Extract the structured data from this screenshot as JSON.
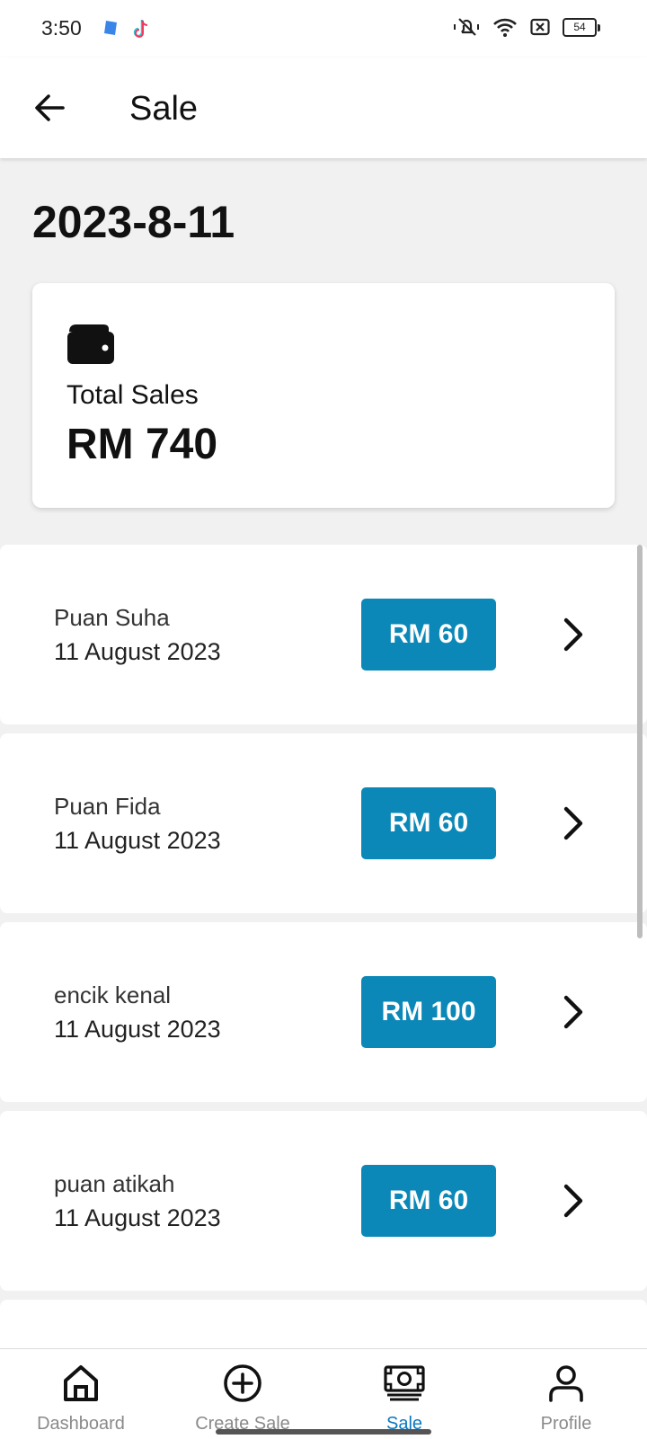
{
  "status_bar": {
    "time": "3:50",
    "battery": "54"
  },
  "app_bar": {
    "title": "Sale"
  },
  "date_heading": "2023-8-11",
  "summary": {
    "label": "Total Sales",
    "value": "RM 740"
  },
  "sales": [
    {
      "name": "Puan Suha",
      "date": " 11 August 2023",
      "amount": "RM 60"
    },
    {
      "name": "Puan Fida",
      "date": " 11 August 2023",
      "amount": "RM 60"
    },
    {
      "name": "encik kenal",
      "date": " 11 August 2023",
      "amount": "RM 100"
    },
    {
      "name": "puan atikah",
      "date": " 11 August 2023",
      "amount": "RM 60"
    }
  ],
  "bottom_nav": [
    {
      "label": "Dashboard",
      "icon": "home-icon",
      "active": false
    },
    {
      "label": "Create Sale",
      "icon": "plus-circle-icon",
      "active": false
    },
    {
      "label": "Sale",
      "icon": "money-icon",
      "active": true
    },
    {
      "label": "Profile",
      "icon": "person-icon",
      "active": false
    }
  ],
  "colors": {
    "accent": "#0b88b7",
    "active_nav": "#0b78c0",
    "background": "#f1f1f1"
  }
}
